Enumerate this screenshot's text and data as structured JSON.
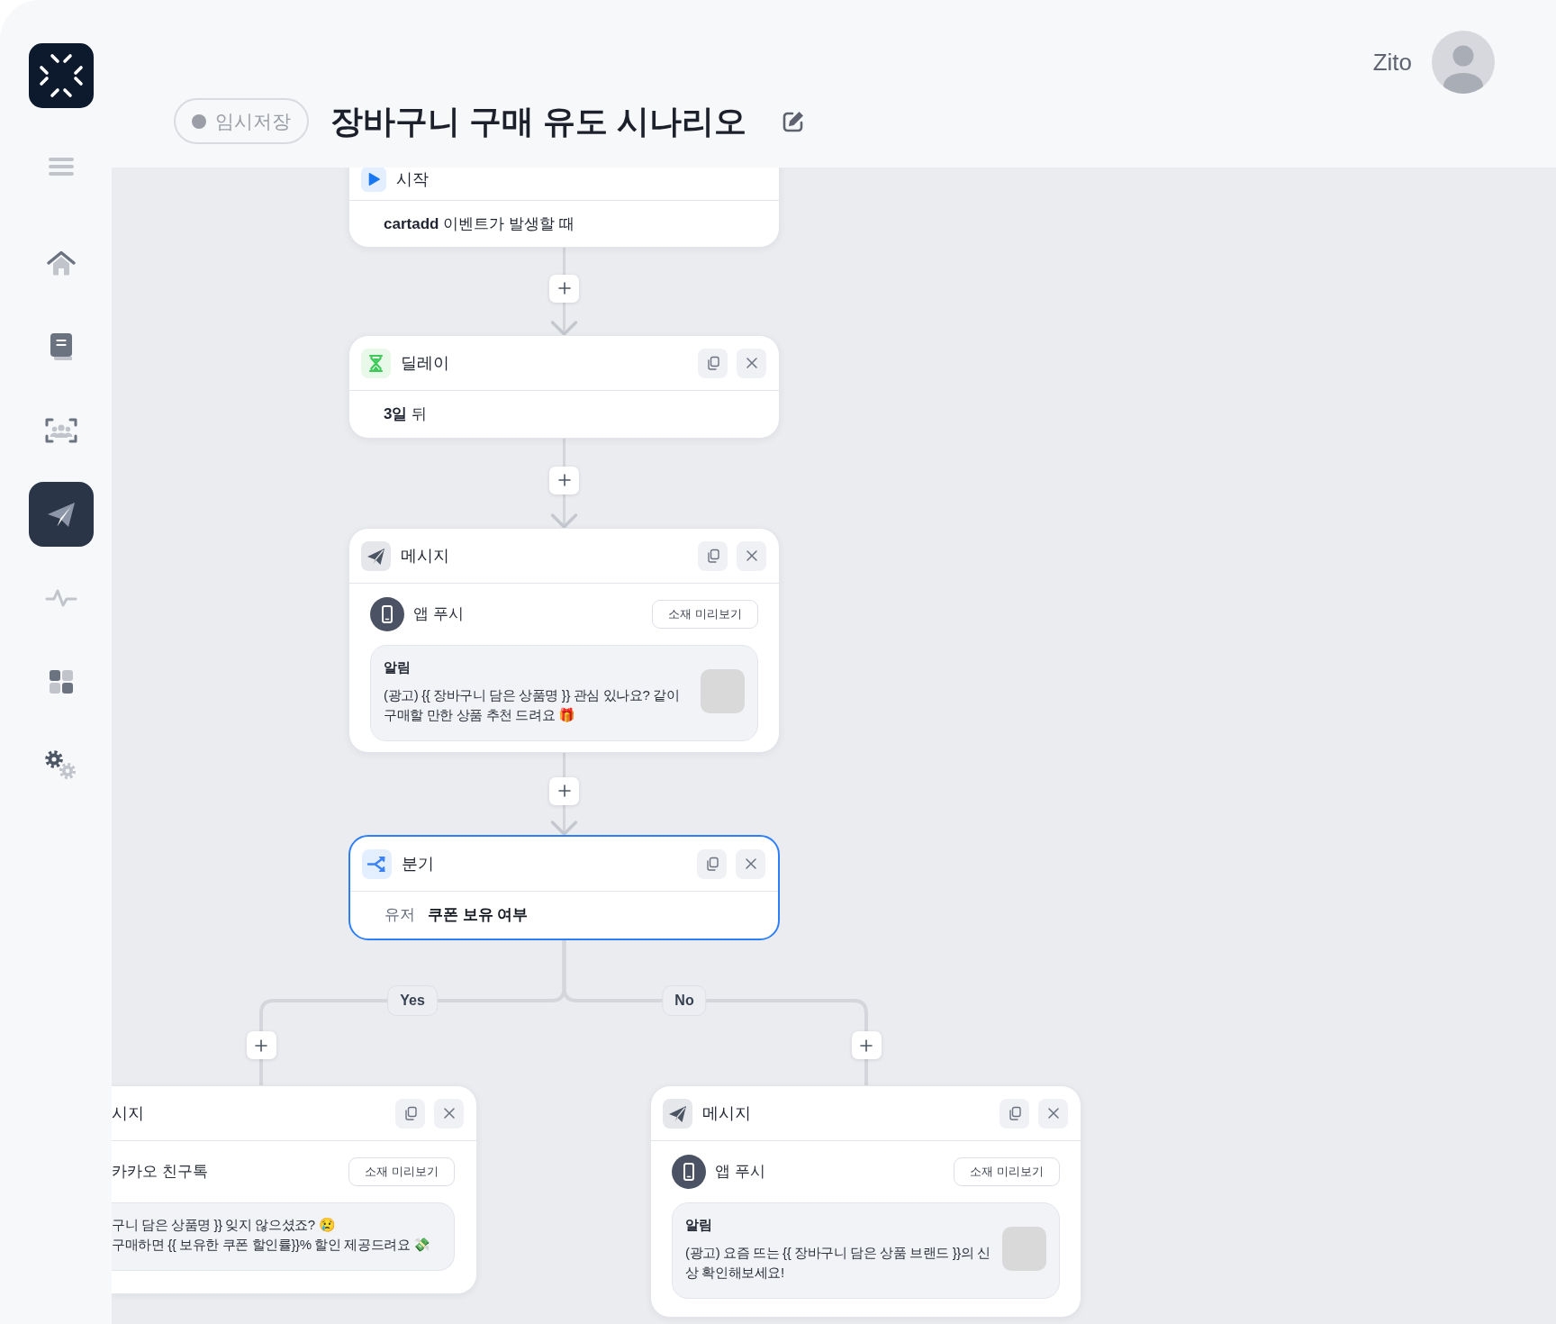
{
  "header": {
    "status": {
      "label": "임시저장"
    },
    "title": "장바구니 구매 유도 시나리오",
    "user": {
      "name": "Zito"
    }
  },
  "sidebar": {
    "items": [
      {
        "selected": false
      },
      {
        "selected": false
      },
      {
        "selected": false
      },
      {
        "selected": true
      },
      {
        "selected": false
      },
      {
        "selected": false
      },
      {
        "selected": false
      }
    ]
  },
  "flow": {
    "nodes": [
      {
        "kind": "start",
        "title": "시작",
        "body": "**cartadd** 이벤트가 발생할 때",
        "selected": false
      },
      {
        "kind": "delay",
        "title": "딜레이",
        "body": "**3일** 뒤",
        "selected": false
      },
      {
        "kind": "message",
        "title": "메시지",
        "channel": {
          "kind": "app_push",
          "label": "앱 푸시"
        },
        "preview_label": "소재 미리보기",
        "content": {
          "heading": "알림",
          "text": "(광고) {{ 장바구니 담은 상품명 }} 관심 있나요? 같이 구매할 만한 상품 추천 드려요 🎁",
          "image": true
        },
        "selected": false
      },
      {
        "kind": "branch",
        "title": "분기",
        "subject": "유저",
        "condition": "쿠폰 보유 여부",
        "selected": true
      }
    ],
    "branches": [
      {
        "label": "Yes",
        "nodes": [
          {
            "kind": "message",
            "title": "시지",
            "channel": {
              "label": "카카오 친구톡"
            },
            "preview_label": "소재 미리보기",
            "content": {
              "text": "구니 담은 상품명 }} 잊지 않으셨죠? 😢\n구매하면 {{ 보유한 쿠폰 할인률}}% 할인 제공드려요 💸"
            },
            "selected": false
          }
        ]
      },
      {
        "label": "No",
        "nodes": [
          {
            "kind": "message",
            "title": "메시지",
            "channel": {
              "kind": "app_push",
              "label": "앱 푸시"
            },
            "preview_label": "소재 미리보기",
            "content": {
              "heading": "알림",
              "text": "(광고) 요즘 뜨는 {{ 장바구니 담은 상품 브랜드 }}의 신상 확인해보세요!",
              "image": true
            },
            "selected": false
          }
        ]
      }
    ]
  }
}
